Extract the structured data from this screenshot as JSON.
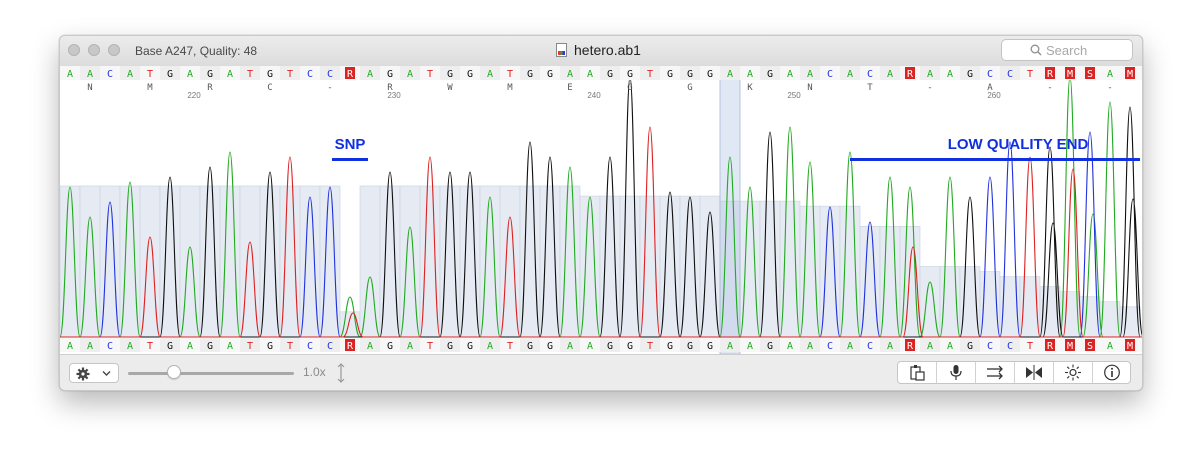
{
  "window": {
    "status": "Base A247, Quality: 48",
    "title": "hetero.ab1",
    "search_placeholder": "Search"
  },
  "sequence": {
    "bases": [
      "A",
      "A",
      "C",
      "A",
      "T",
      "G",
      "A",
      "G",
      "A",
      "T",
      "G",
      "T",
      "C",
      "C",
      "R",
      "A",
      "G",
      "A",
      "T",
      "G",
      "G",
      "A",
      "T",
      "G",
      "G",
      "A",
      "A",
      "G",
      "G",
      "T",
      "G",
      "G",
      "G",
      "A",
      "A",
      "G",
      "A",
      "A",
      "C",
      "A",
      "C",
      "A",
      "R",
      "A",
      "A",
      "G",
      "C",
      "C",
      "T",
      "R",
      "M",
      "S",
      "A",
      "M"
    ],
    "translation": [
      "N",
      "M",
      "R",
      "C",
      "-",
      "R",
      "W",
      "M",
      "E",
      "G",
      "G",
      "K",
      "N",
      "T",
      "-",
      "A",
      "-",
      "-"
    ],
    "position_labels": [
      "220",
      "230",
      "240",
      "250",
      "260"
    ],
    "selected_base_index": 33,
    "colors": {
      "A": "#22aa22",
      "C": "#2233dd",
      "G": "#111111",
      "T": "#dd2222",
      "ambiguous": "#dd2222"
    }
  },
  "annotations": {
    "snp": "SNP",
    "low_quality_end": "LOW QUALITY END",
    "label_color": "#1030e0"
  },
  "quality": {
    "values": [
      30,
      30,
      30,
      30,
      30,
      30,
      30,
      30,
      30,
      30,
      30,
      30,
      30,
      30,
      5,
      30,
      30,
      30,
      30,
      30,
      30,
      30,
      30,
      30,
      30,
      30,
      28,
      28,
      28,
      28,
      28,
      28,
      28,
      27,
      27,
      27,
      27,
      26,
      26,
      26,
      22,
      22,
      22,
      14,
      14,
      14,
      13,
      12,
      12,
      10,
      9,
      8,
      7,
      6
    ]
  },
  "toolbar": {
    "zoom": "1.0x",
    "icons": [
      "gear-icon",
      "copy-icon",
      "microphone-icon",
      "arrows-icon",
      "bowtie-icon",
      "brightness-icon",
      "info-icon"
    ]
  }
}
